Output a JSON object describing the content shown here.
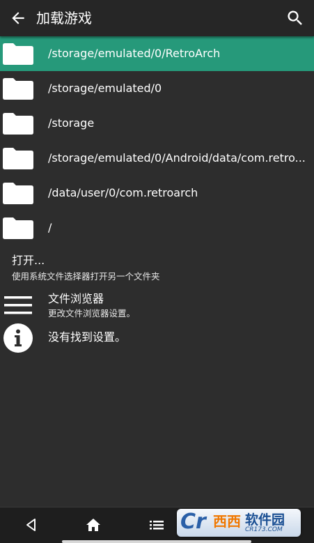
{
  "header": {
    "title": "加载游戏",
    "back_icon": "arrow-left-icon",
    "search_icon": "search-icon"
  },
  "folders": [
    {
      "path": "/storage/emulated/0/RetroArch",
      "selected": true
    },
    {
      "path": "/storage/emulated/0",
      "selected": false
    },
    {
      "path": "/storage",
      "selected": false
    },
    {
      "path": "/storage/emulated/0/Android/data/com.retro...",
      "selected": false
    },
    {
      "path": "/data/user/0/com.retroarch",
      "selected": false
    },
    {
      "path": "/",
      "selected": false
    }
  ],
  "open_item": {
    "title": "打开...",
    "subtitle": "使用系统文件选择器打开另一个文件夹"
  },
  "file_browser": {
    "title": "文件浏览器",
    "subtitle": "更改文件浏览器设置。"
  },
  "info": {
    "text": "没有找到设置。"
  },
  "navbar": {
    "back_icon": "triangle-back-icon",
    "home_icon": "home-icon",
    "menu_icon": "list-menu-icon"
  },
  "watermark": {
    "logo": "Cr",
    "brand": "西西",
    "name": "软件园",
    "domain": "CR173.COM"
  },
  "colors": {
    "background": "#2d2d2d",
    "appbar": "#262626",
    "selected": "#26997a",
    "text": "#ffffff"
  }
}
